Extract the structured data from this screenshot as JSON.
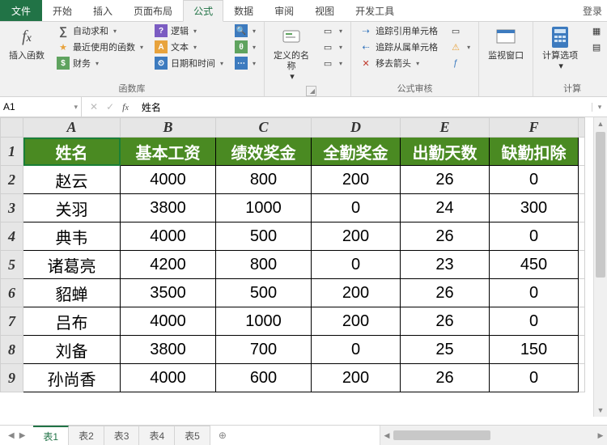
{
  "tabs": {
    "file": "文件",
    "items": [
      "开始",
      "插入",
      "页面布局",
      "公式",
      "数据",
      "审阅",
      "视图",
      "开发工具"
    ],
    "active_index": 3,
    "login": "登录"
  },
  "ribbon": {
    "g1": {
      "insert_fn": "插入函数",
      "autosum": "自动求和",
      "recent": "最近使用的函数",
      "financial": "财务",
      "logical": "逻辑",
      "text": "文本",
      "datetime": "日期和时间",
      "group_label": "函数库"
    },
    "g2": {
      "define_name": "定义的名称"
    },
    "g3": {
      "trace_precedents": "追踪引用单元格",
      "trace_dependents": "追踪从属单元格",
      "remove_arrows": "移去箭头",
      "group_label": "公式审核"
    },
    "g4": {
      "watch": "监视窗口"
    },
    "g5": {
      "calc_options": "计算选项",
      "group_label": "计算"
    }
  },
  "namebox": "A1",
  "formula_value": "姓名",
  "columns": [
    "A",
    "B",
    "C",
    "D",
    "E",
    "F"
  ],
  "headers": [
    "姓名",
    "基本工资",
    "绩效奖金",
    "全勤奖金",
    "出勤天数",
    "缺勤扣除"
  ],
  "rows": [
    {
      "n": "2",
      "c": [
        "赵云",
        "4000",
        "800",
        "200",
        "26",
        "0"
      ]
    },
    {
      "n": "3",
      "c": [
        "关羽",
        "3800",
        "1000",
        "0",
        "24",
        "300"
      ]
    },
    {
      "n": "4",
      "c": [
        "典韦",
        "4000",
        "500",
        "200",
        "26",
        "0"
      ]
    },
    {
      "n": "5",
      "c": [
        "诸葛亮",
        "4200",
        "800",
        "0",
        "23",
        "450"
      ]
    },
    {
      "n": "6",
      "c": [
        "貂蝉",
        "3500",
        "500",
        "200",
        "26",
        "0"
      ]
    },
    {
      "n": "7",
      "c": [
        "吕布",
        "4000",
        "1000",
        "200",
        "26",
        "0"
      ]
    },
    {
      "n": "8",
      "c": [
        "刘备",
        "3800",
        "700",
        "0",
        "25",
        "150"
      ]
    },
    {
      "n": "9",
      "c": [
        "孙尚香",
        "4000",
        "600",
        "200",
        "26",
        "0"
      ]
    }
  ],
  "sheet_tabs": [
    "表1",
    "表2",
    "表3",
    "表4",
    "表5"
  ],
  "active_sheet": 0
}
